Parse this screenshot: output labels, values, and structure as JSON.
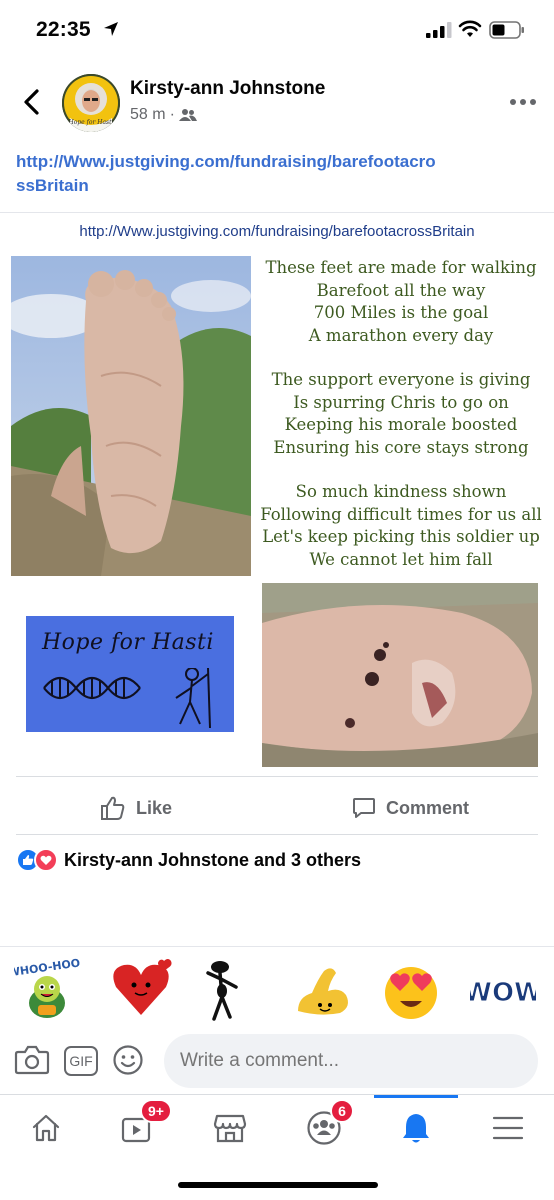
{
  "status_bar": {
    "time": "22:35"
  },
  "post": {
    "author": "Kirsty-ann Johnstone",
    "time_ago": "58 m",
    "separator": "·",
    "avatar_caption": "Hope for Hasti",
    "link_text": "http://Www.justgiving.com/fundraising/barefootacrossBritain"
  },
  "flyer": {
    "url": "http://Www.justgiving.com/fundraising/barefootacrossBritain",
    "poem": [
      [
        "These feet are made for walking",
        "Barefoot all the way",
        "700 Miles is the goal",
        "A marathon every day"
      ],
      [
        "The support everyone is giving",
        "Is spurring Chris to go on",
        "Keeping his morale boosted",
        "Ensuring his core stays strong"
      ],
      [
        "So much kindness shown",
        "Following difficult times for us all",
        "Let's keep picking this soldier up",
        "We cannot let him fall"
      ]
    ],
    "logo_text": "Hope for Hasti"
  },
  "actions": {
    "like": "Like",
    "comment": "Comment"
  },
  "reactions": {
    "summary": "Kirsty-ann Johnstone and 3 others"
  },
  "stickers": [
    "whoo-hoo-turtle",
    "heart-character",
    "dancing-stick-figure",
    "flexing-arm",
    "heart-eyes-emoji",
    "wow-text"
  ],
  "sticker_text": {
    "whoo": "WHOO-HOO!",
    "wow": "WOW"
  },
  "composer": {
    "placeholder": "Write a comment...",
    "gif_label": "GIF"
  },
  "tab_bar": {
    "watch_badge": "9+",
    "groups_badge": "6",
    "active_tab": "notifications"
  },
  "colors": {
    "brand": "#1877f2",
    "link": "#3b6fd0",
    "badge": "#e41e3f",
    "poem": "#3d5a20",
    "logo_bg": "#4a6fe0"
  }
}
